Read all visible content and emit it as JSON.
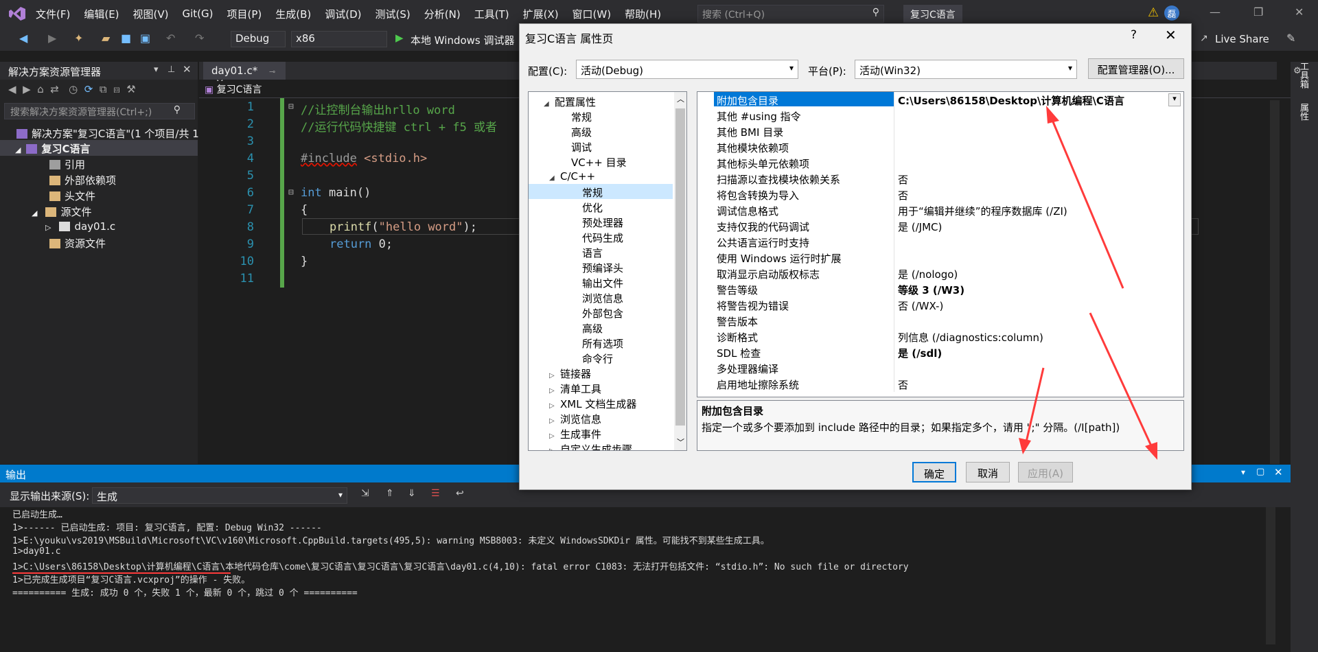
{
  "menubar": {
    "items": [
      "文件(F)",
      "编辑(E)",
      "视图(V)",
      "Git(G)",
      "项目(P)",
      "生成(B)",
      "调试(D)",
      "测试(S)",
      "分析(N)",
      "工具(T)",
      "扩展(X)",
      "窗口(W)",
      "帮助(H)"
    ],
    "search_placeholder": "搜索 (Ctrl+Q)",
    "solution_name": "复习C语言",
    "avatar": "磊"
  },
  "toolbar": {
    "config": "Debug",
    "platform": "x86",
    "run_label": "本地 Windows 调试器",
    "live_share": "Live Share"
  },
  "solution_explorer": {
    "title": "解决方案资源管理器",
    "search_placeholder": "搜索解决方案资源管理器(Ctrl+;)",
    "items": [
      {
        "label": "解决方案\"复习C语言\"(1 个项目/共 1"
      },
      {
        "label": "复习C语言"
      },
      {
        "label": "引用"
      },
      {
        "label": "外部依赖项"
      },
      {
        "label": "头文件"
      },
      {
        "label": "源文件"
      },
      {
        "label": "day01.c"
      },
      {
        "label": "资源文件"
      }
    ]
  },
  "editor": {
    "tab": "day01.c*",
    "breadcrumb": "复习C语言",
    "lines": [
      "1",
      "2",
      "3",
      "4",
      "5",
      "6",
      "7",
      "8",
      "9",
      "10",
      "11"
    ],
    "code": {
      "l1": "//让控制台输出hrllo word",
      "l2": "//运行代码快捷键 ctrl + f5 或者",
      "l4_pp": "#include",
      "l4_inc": " <stdio.h>",
      "l6_kw": "int",
      "l6_rest": " main()",
      "l7": "{",
      "l8_fn": "printf",
      "l8_open": "(",
      "l8_str": "\"hello word\"",
      "l8_close": ");",
      "l9_kw": "return",
      "l9_rest": " 0;",
      "l10": "}"
    }
  },
  "output": {
    "title": "输出",
    "source_label": "显示输出来源(S):",
    "source_value": "生成",
    "lines": [
      "已启动生成…",
      "1>------ 已启动生成: 项目: 复习C语言, 配置: Debug Win32 ------",
      "1>E:\\youku\\vs2019\\MSBuild\\Microsoft\\VC\\v160\\Microsoft.CppBuild.targets(495,5): warning MSB8003: 未定义 WindowsSDKDir 属性。可能找不到某些生成工具。",
      "1>day01.c",
      "1>C:\\Users\\86158\\Desktop\\计算机编程\\C语言\\本地代码仓库\\come\\复习C语言\\复习C语言\\复习C语言\\day01.c(4,10): fatal error C1083: 无法打开包括文件: “stdio.h”: No such file or directory",
      "1>已完成生成项目“复习C语言.vcxproj”的操作 - 失败。",
      "========== 生成: 成功 0 个，失败 1 个，最新 0 个，跳过 0 个 =========="
    ]
  },
  "right_strip": {
    "toolbox": "工具箱",
    "properties": "属性"
  },
  "dialog": {
    "title": "复习C语言 属性页",
    "help": "?",
    "config_label": "配置(C):",
    "config_value": "活动(Debug)",
    "platform_label": "平台(P):",
    "platform_value": "活动(Win32)",
    "config_manager": "配置管理器(O)...",
    "tree": [
      {
        "label": "配置属性",
        "toggle": "◢"
      },
      {
        "label": "常规",
        "toggle": ""
      },
      {
        "label": "高级",
        "toggle": ""
      },
      {
        "label": "调试",
        "toggle": ""
      },
      {
        "label": "VC++ 目录",
        "toggle": ""
      },
      {
        "label": "C/C++",
        "toggle": "◢"
      },
      {
        "label": "常规",
        "toggle": ""
      },
      {
        "label": "优化",
        "toggle": ""
      },
      {
        "label": "预处理器",
        "toggle": ""
      },
      {
        "label": "代码生成",
        "toggle": ""
      },
      {
        "label": "语言",
        "toggle": ""
      },
      {
        "label": "预编译头",
        "toggle": ""
      },
      {
        "label": "输出文件",
        "toggle": ""
      },
      {
        "label": "浏览信息",
        "toggle": ""
      },
      {
        "label": "外部包含",
        "toggle": ""
      },
      {
        "label": "高级",
        "toggle": ""
      },
      {
        "label": "所有选项",
        "toggle": ""
      },
      {
        "label": "命令行",
        "toggle": ""
      },
      {
        "label": "链接器",
        "toggle": "▷"
      },
      {
        "label": "清单工具",
        "toggle": "▷"
      },
      {
        "label": "XML 文档生成器",
        "toggle": "▷"
      },
      {
        "label": "浏览信息",
        "toggle": "▷"
      },
      {
        "label": "生成事件",
        "toggle": "▷"
      },
      {
        "label": "自定义生成步骤",
        "toggle": "▷"
      }
    ],
    "properties": [
      {
        "name": "附加包含目录",
        "value": "C:\\Users\\86158\\Desktop\\计算机编程\\C语言"
      },
      {
        "name": "其他 #using 指令",
        "value": ""
      },
      {
        "name": "其他 BMI 目录",
        "value": ""
      },
      {
        "name": "其他模块依赖项",
        "value": ""
      },
      {
        "name": "其他标头单元依赖项",
        "value": ""
      },
      {
        "name": "扫描源以查找模块依赖关系",
        "value": "否"
      },
      {
        "name": "将包含转换为导入",
        "value": "否"
      },
      {
        "name": "调试信息格式",
        "value": "用于“编辑并继续”的程序数据库 (/ZI)"
      },
      {
        "name": "支持仅我的代码调试",
        "value": "是 (/JMC)"
      },
      {
        "name": "公共语言运行时支持",
        "value": ""
      },
      {
        "name": "使用 Windows 运行时扩展",
        "value": ""
      },
      {
        "name": "取消显示启动版权标志",
        "value": "是 (/nologo)"
      },
      {
        "name": "警告等级",
        "value": "等级 3 (/W3)"
      },
      {
        "name": "将警告视为错误",
        "value": "否 (/WX-)"
      },
      {
        "name": "警告版本",
        "value": ""
      },
      {
        "name": "诊断格式",
        "value": "列信息 (/diagnostics:column)"
      },
      {
        "name": "SDL 检查",
        "value": "是 (/sdl)"
      },
      {
        "name": "多处理器编译",
        "value": ""
      },
      {
        "name": "启用地址擦除系统",
        "value": "否"
      }
    ],
    "desc_title": "附加包含目录",
    "desc_text": "指定一个或多个要添加到 include 路径中的目录；如果指定多个，请用 \";\" 分隔。(/I[path])",
    "ok": "确定",
    "cancel": "取消",
    "apply": "应用(A)"
  },
  "colors": {
    "accent": "#007acc",
    "selection": "#0078d7",
    "annotation": "#ff3b3b"
  }
}
